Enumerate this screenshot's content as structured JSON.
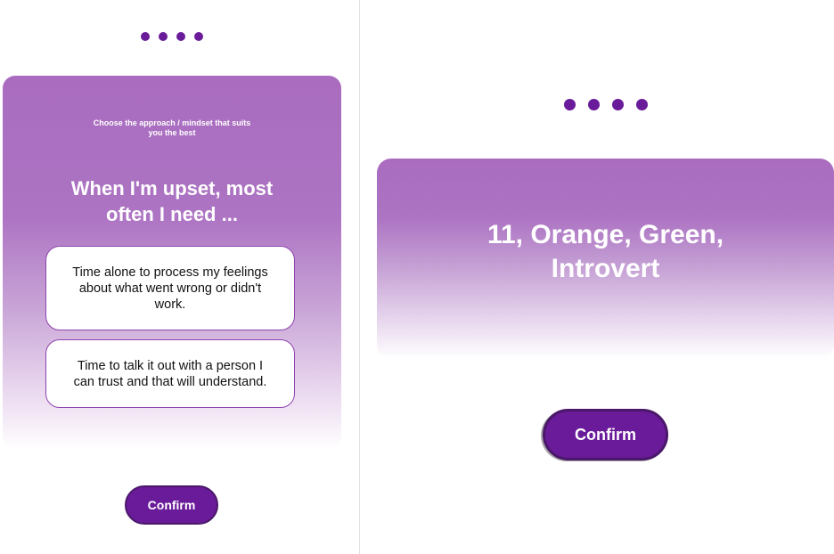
{
  "left_screen": {
    "instruction_lines": [
      "Choose the approach / mindset that suits",
      "you the best"
    ],
    "question_lines": [
      "When I'm upset, most",
      "often I need ..."
    ],
    "options": [
      {
        "lines": [
          "Time alone to process my feelings",
          "about what went wrong or didn't",
          "work."
        ]
      },
      {
        "lines": [
          "Time to talk it out with a person I",
          "can trust and that will understand."
        ]
      }
    ],
    "confirm_label": "Confirm"
  },
  "right_screen": {
    "result_lines": [
      "11, Orange, Green,",
      "Introvert"
    ],
    "confirm_label": "Confirm"
  },
  "colors": {
    "accent": "#6a1b9a",
    "card_gradient_top": "#a96cbf",
    "option_border": "#8e44ad"
  }
}
